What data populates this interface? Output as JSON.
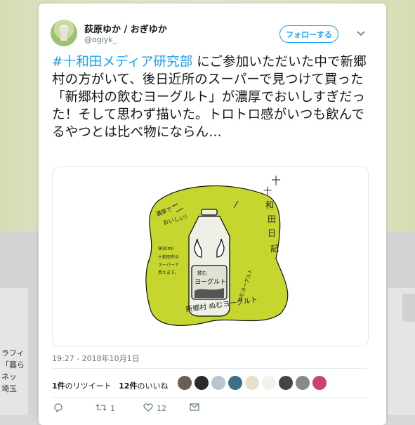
{
  "background": {
    "left_lines": [
      "ラフィ",
      "「暮ら",
      "ネッ",
      "埼玉"
    ]
  },
  "tweet": {
    "user": {
      "name": "荻原ゆか / おぎゆか",
      "handle": "@ogiyk_"
    },
    "follow_label": "フォローする",
    "hashtag": "#十和田メディア研究部",
    "body": "にご参加いただいた中で新郷村の方がいて、後日近所のスーパーで見つけて買った「新郷村の飲むヨーグルト」が濃厚でおいしすぎだった！そして思わず描いた。トロトロ感がいつも飲んでるやつとは比べ物にならん…",
    "timestamp": "19:27 - 2018年10月1日",
    "stats": {
      "retweets_num": "1件",
      "retweets_label": "のリツイート",
      "likes_num": "12件",
      "likes_label": "のいいね"
    },
    "actions": {
      "retweets": "1",
      "likes": "12"
    }
  },
  "illustration": {
    "blob_color": "#c5d62f",
    "bottle_label_lines": [
      "飲む",
      "ヨーグルト"
    ],
    "side_title": [
      "十",
      "和",
      "田",
      "日",
      "記"
    ],
    "note_top": [
      "濃厚で",
      "おいしい！"
    ],
    "note_mid": [
      "900ml",
      "十和田市の",
      "スーパーで",
      "買えます。"
    ],
    "bottom_text": "新郷村 ぬむヨーグルト",
    "right_curve_text": "ぬむヨーグルト"
  }
}
